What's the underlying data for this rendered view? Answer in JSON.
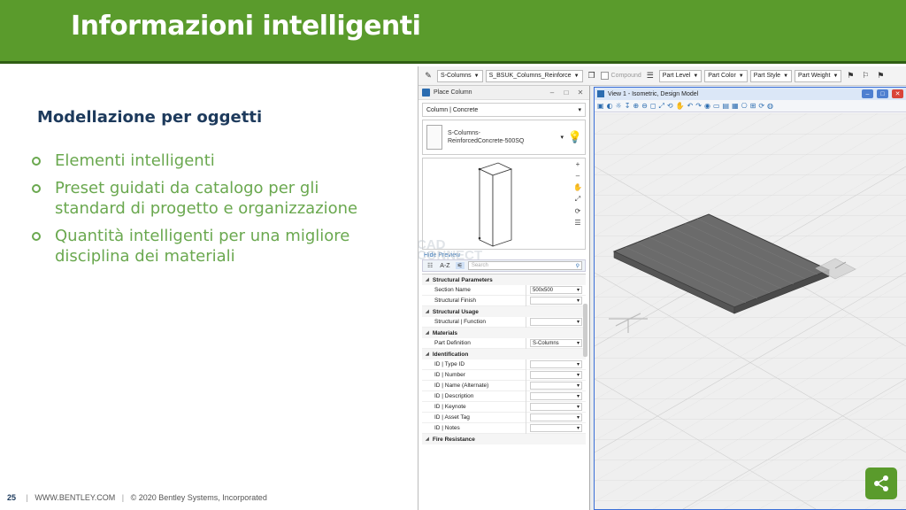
{
  "slide": {
    "title": "Informazioni intelligenti",
    "subtitle": "Modellazione per oggetti",
    "bullets": [
      "Elementi intelligenti",
      "Preset guidati da catalogo per gli standard di progetto e organizzazione",
      "Quantità intelligenti per una migliore disciplina dei materiali"
    ],
    "footer": {
      "page_number": "25",
      "website": "WWW.BENTLEY.COM",
      "copyright": "© 2020 Bentley Systems, Incorporated"
    }
  },
  "toolbar": {
    "family": "S-Columns",
    "part": "S_BSUK_Columns_Reinforce",
    "compound": "Compound",
    "level": "Part Level",
    "color": "Part Color",
    "style": "Part Style",
    "weight": "Part Weight"
  },
  "dialog": {
    "title": "Place Column",
    "category": "Column | Concrete",
    "item_line1": "S-Columns-",
    "item_line2": "ReinforcedConcrete-500SQ",
    "hide_preview": "Hide Preview",
    "sort_label": "A-Z",
    "search_placeholder": "Search",
    "sections": {
      "structural_parameters": "Structural Parameters",
      "structural_usage": "Structural Usage",
      "materials": "Materials",
      "identification": "Identification",
      "fire_resistance": "Fire Resistance"
    },
    "properties": {
      "section_name": {
        "label": "Section Name",
        "value": "500x500"
      },
      "structural_finish": {
        "label": "Structural Finish",
        "value": ""
      },
      "structural_function": {
        "label": "Structural | Function",
        "value": ""
      },
      "part_definition": {
        "label": "Part Definition",
        "value": "S-Columns"
      },
      "type_id": {
        "label": "ID | Type ID",
        "value": ""
      },
      "number": {
        "label": "ID | Number",
        "value": ""
      },
      "name_alt": {
        "label": "ID | Name (Alternate)",
        "value": ""
      },
      "description": {
        "label": "ID | Description",
        "value": ""
      },
      "keynote": {
        "label": "ID | Keynote",
        "value": ""
      },
      "asset_tag": {
        "label": "ID | Asset Tag",
        "value": ""
      },
      "notes": {
        "label": "ID | Notes",
        "value": ""
      }
    }
  },
  "view": {
    "title": "View 1 - Isometric, Design Model"
  },
  "watermark": "CAD CONNECT",
  "colors": {
    "title_green": "#5a9b2c",
    "bullet_green": "#6aa84f",
    "subtitle_navy": "#1d3a5c"
  }
}
